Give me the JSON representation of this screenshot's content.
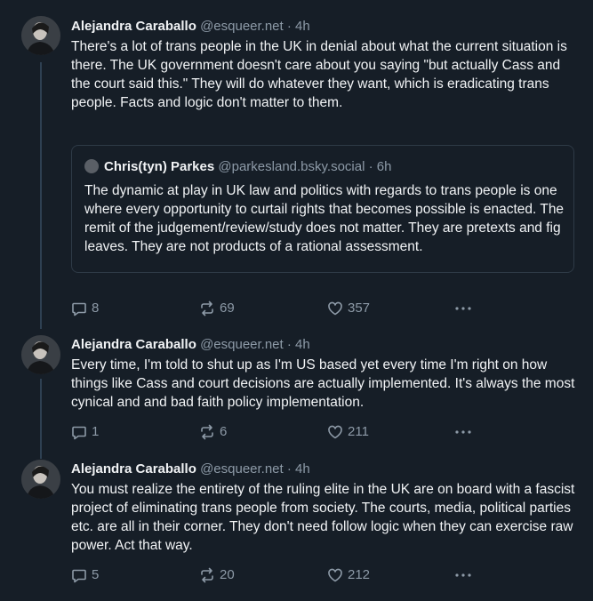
{
  "posts": [
    {
      "name": "Alejandra Caraballo",
      "handle": "@esqueer.net",
      "dot": "·",
      "time": "4h",
      "text": "There's a lot of trans people in the UK in denial about what the current situation is there. The UK government doesn't care about you saying \"but actually Cass and the court said this.\" They will do whatever they want, which is eradicating trans people. Facts and logic don't matter to them.",
      "quote": {
        "name": "Chris(tyn) Parkes",
        "handle": "@parkesland.bsky.social",
        "dot": "·",
        "time": "6h",
        "text": "The dynamic at play in UK law and politics with regards to trans people is one where every opportunity to curtail rights that becomes possible is enacted. The remit of the judgement/review/study does not matter. They are pretexts and fig leaves. They are not products of a rational assessment."
      },
      "replies": "8",
      "reposts": "69",
      "likes": "357"
    },
    {
      "name": "Alejandra Caraballo",
      "handle": "@esqueer.net",
      "dot": "·",
      "time": "4h",
      "text": "Every time, I'm told to shut up as I'm US based yet every time I'm right on how things like Cass and court decisions are actually implemented. It's always the most cynical and and bad faith policy implementation.",
      "replies": "1",
      "reposts": "6",
      "likes": "211"
    },
    {
      "name": "Alejandra Caraballo",
      "handle": "@esqueer.net",
      "dot": "·",
      "time": "4h",
      "text": "You must realize the entirety of the ruling elite in the UK are on board with a fascist project of eliminating trans people from society. The courts, media, political parties etc. are all in their corner. They don't need follow logic when they can exercise raw power. Act that way.",
      "replies": "5",
      "reposts": "20",
      "likes": "212"
    }
  ],
  "colors": {
    "background": "#161e27",
    "text": "#f1f3f5",
    "muted": "#8d9aa7",
    "thread_line": "#2e4052",
    "quote_border": "#2e3a46"
  },
  "icons": [
    "reply-icon",
    "repost-icon",
    "like-icon",
    "more-icon"
  ]
}
